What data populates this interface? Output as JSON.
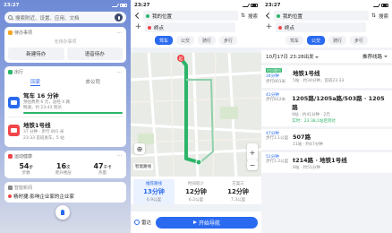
{
  "screen1": {
    "status_time": "23:27",
    "search_placeholder": "搜索附近、设置、应用、文档",
    "todo": {
      "title": "待办事项",
      "empty": "无待办事项",
      "btn_new": "新建待办",
      "btn_voice": "语音待办"
    },
    "trip": {
      "title": "出行",
      "tabs": [
        "回家",
        "去公司"
      ],
      "routes": [
        {
          "icon_color": "#2a6af0",
          "title": "驾车 16 分钟",
          "sub": "预估费用 6 元，途经 X 路\n畅通，约 23:43 到达",
          "extra": ""
        },
        {
          "icon_color": "#f0464a",
          "title": "地铁1号线",
          "sub": "37 分钟 · 步行 801 米",
          "extra": "23:33 首班发车，5 站"
        }
      ]
    },
    "health": {
      "title": "运动健康",
      "stats": [
        {
          "value": "54",
          "unit": "步",
          "label": "步数"
        },
        {
          "value": "16",
          "unit": "次",
          "label": "爬升楼层"
        },
        {
          "value": "47",
          "unit": "千卡",
          "label": "热量"
        }
      ]
    },
    "news": {
      "title": "智能新闻",
      "headline": "杨时捷:影响企业家的企业家"
    }
  },
  "screen2": {
    "status_time": "23:27",
    "from": "我的位置",
    "to": "终点",
    "search_label": "搜索",
    "modes": [
      "驾车",
      "公交",
      "骑行",
      "步行"
    ],
    "active_mode": "驾车",
    "map_start_label": "起",
    "smart_label": "智能路线",
    "route_options": [
      {
        "label": "推荐路线",
        "time": "13分钟",
        "detail": "6.9公里"
      },
      {
        "label": "时间较少",
        "time": "12分钟",
        "detail": "6.2公里"
      },
      {
        "label": "方案三",
        "time": "12分钟",
        "detail": "7.3公里"
      }
    ],
    "radar": "雷达",
    "start_nav": "开始导航",
    "colors": {
      "route": "#2cb56a",
      "primary": "#2a6af0",
      "start": "#f0464a"
    }
  },
  "screen3": {
    "status_time": "23:27",
    "from": "我的位置",
    "to": "终点",
    "search_label": "搜索",
    "modes": [
      "驾车",
      "公交",
      "骑行",
      "步行"
    ],
    "active_mode": "公交",
    "depart_time": "10月17日 23:28出发",
    "sort": "推荐线路",
    "routes": [
      {
        "badge": "时间最短",
        "duration": "34分钟",
        "walk": "步行801米",
        "title": "地铁1号线",
        "detail": "5站 · 约34分钟，首班23:33",
        "live": ""
      },
      {
        "badge": "",
        "duration": "41分钟",
        "walk": "步行812米",
        "title": "1205路/1205a路/503路 · 1205路",
        "detail": "9站 · 约41分钟 · 2元",
        "live": "实时：23:38,1站后到达"
      },
      {
        "badge": "",
        "duration": "47分钟",
        "walk": "步行1.1公里",
        "title": "507路",
        "detail": "11站 · 约47分钟",
        "live": ""
      },
      {
        "badge": "",
        "duration": "51分钟",
        "walk": "步行1.2公里",
        "title": "t214路 · 地铁1号线",
        "detail": "8站 · 约51分钟",
        "live": ""
      }
    ]
  }
}
